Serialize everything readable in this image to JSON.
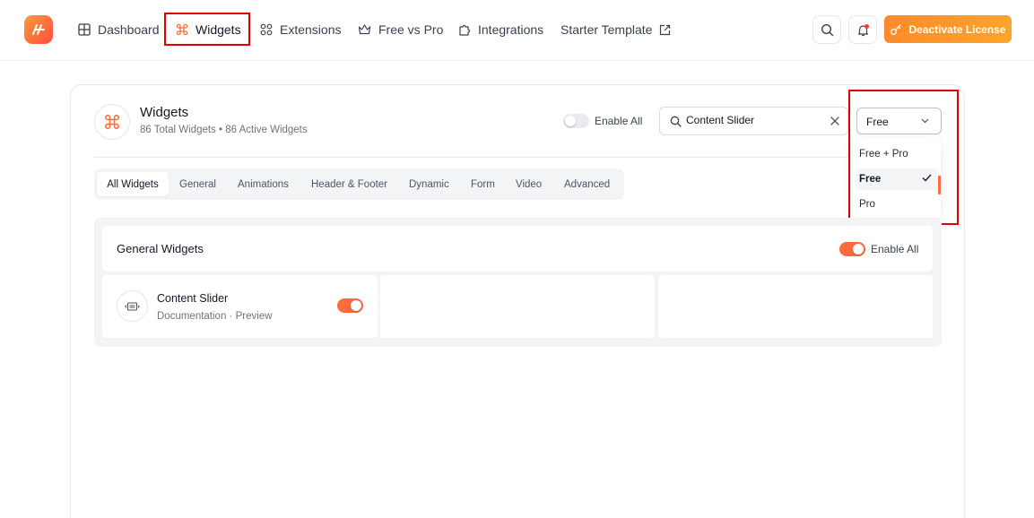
{
  "nav": {
    "items": [
      {
        "label": "Dashboard",
        "icon": "grid-icon"
      },
      {
        "label": "Widgets",
        "icon": "command-icon",
        "active": true
      },
      {
        "label": "Extensions",
        "icon": "extensions-icon"
      },
      {
        "label": "Free vs Pro",
        "icon": "crown-icon"
      },
      {
        "label": "Integrations",
        "icon": "puzzle-icon"
      },
      {
        "label": "Starter Template",
        "icon": "external-link-icon"
      }
    ],
    "cta_label": "Deactivate License",
    "accent_color": "#ff6b3d",
    "highlight_color": "#e00000"
  },
  "header": {
    "title": "Widgets",
    "subtitle": "86 Total Widgets • 86 Active Widgets",
    "enable_all_label": "Enable All",
    "enable_all_on": false
  },
  "search": {
    "value": "Content Slider"
  },
  "filter": {
    "selected": "Free",
    "options": [
      "Free + Pro",
      "Free",
      "Pro"
    ]
  },
  "tabs": [
    "All Widgets",
    "General",
    "Animations",
    "Header & Footer",
    "Dynamic",
    "Form",
    "Video",
    "Advanced"
  ],
  "section": {
    "title": "General Widgets",
    "enable_all_label": "Enable All",
    "enable_all_on": true
  },
  "widgets": [
    {
      "name": "Content Slider",
      "doc_label": "Documentation",
      "separator": " · ",
      "preview_label": "Preview",
      "enabled": true
    }
  ]
}
